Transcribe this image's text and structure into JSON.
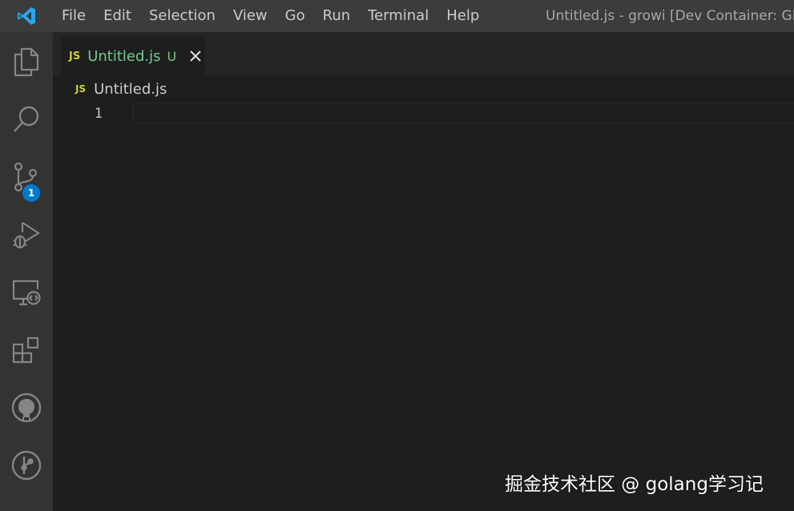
{
  "titlebar": {
    "logo_icon": "vscode-logo-icon",
    "menu": [
      "File",
      "Edit",
      "Selection",
      "View",
      "Go",
      "Run",
      "Terminal",
      "Help"
    ],
    "window_title": "Untitled.js - growi [Dev Container: GRO"
  },
  "activitybar": {
    "items": [
      {
        "name": "explorer",
        "icon": "files-icon"
      },
      {
        "name": "search",
        "icon": "search-icon"
      },
      {
        "name": "source-control",
        "icon": "source-control-icon",
        "badge": "1"
      },
      {
        "name": "run-debug",
        "icon": "run-debug-icon"
      },
      {
        "name": "remote-explorer",
        "icon": "remote-explorer-icon"
      },
      {
        "name": "extensions",
        "icon": "extensions-icon"
      },
      {
        "name": "github",
        "icon": "github-icon"
      },
      {
        "name": "git-graph",
        "icon": "git-graph-icon"
      }
    ]
  },
  "editor": {
    "tab": {
      "lang_badge": "JS",
      "name": "Untitled.js",
      "status": "U",
      "close_icon": "close-icon"
    },
    "breadcrumb": {
      "lang_badge": "JS",
      "name": "Untitled.js"
    },
    "lines": [
      "1"
    ]
  },
  "watermark": "掘金技术社区 @ golang学习记",
  "colors": {
    "titlebar": "#3c3c3c",
    "activitybar": "#333333",
    "editor_bg": "#1e1e1e",
    "tabbar_bg": "#252526",
    "modified_green": "#73c991",
    "js_yellow": "#cbcb41",
    "badge_blue": "#007acc"
  }
}
